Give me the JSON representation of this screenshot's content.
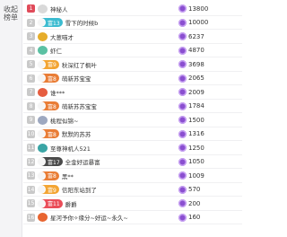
{
  "sidebar": {
    "title_line1": "收起",
    "title_line2": "榜单"
  },
  "colors": {
    "rank_top": "#e04b5a",
    "coin": "#8a4fd0"
  },
  "rows": [
    {
      "rank": "1",
      "level": "",
      "badge_color": "#d9d9d9",
      "name": "神秘人",
      "score": "13800"
    },
    {
      "rank": "2",
      "level": "富13",
      "badge_color": "#3bbbd0",
      "name": "雪下的时候b",
      "score": "10000"
    },
    {
      "rank": "3",
      "level": "",
      "badge_color": "#e6ad2b",
      "name": "大葱喵才",
      "score": "6237"
    },
    {
      "rank": "4",
      "level": "",
      "badge_color": "#5bc1a3",
      "name": "虾仁",
      "score": "4870"
    },
    {
      "rank": "5",
      "level": "富9",
      "badge_color": "#f3a533",
      "name": "秋深红了枫叶",
      "score": "3698"
    },
    {
      "rank": "6",
      "level": "富8",
      "badge_color": "#e97d36",
      "name": "萌新苏宝宝",
      "score": "2065"
    },
    {
      "rank": "7",
      "level": "",
      "badge_color": "#e65d40",
      "name": "谁***",
      "score": "2009"
    },
    {
      "rank": "8",
      "level": "富8",
      "badge_color": "#e97d36",
      "name": "萌新苏苏宝宝",
      "score": "1784"
    },
    {
      "rank": "9",
      "level": "",
      "badge_color": "#9da8c0",
      "name": "桃程似锦~",
      "score": "1500"
    },
    {
      "rank": "10",
      "level": "富8",
      "badge_color": "#e97d36",
      "name": "默默的苏苏",
      "score": "1316"
    },
    {
      "rank": "11",
      "level": "",
      "badge_color": "#3aa5a5",
      "name": "至尊神机人521",
      "score": "1250"
    },
    {
      "rank": "12",
      "level": "富17",
      "badge_color": "#4a4a4a",
      "name": "全金好运暴富",
      "score": "1050"
    },
    {
      "rank": "13",
      "level": "富8",
      "badge_color": "#e97d36",
      "name": "黑**",
      "score": "1009"
    },
    {
      "rank": "14",
      "level": "富9",
      "badge_color": "#f3a533",
      "name": "信阳东站到了",
      "score": "570"
    },
    {
      "rank": "15",
      "level": "富11",
      "badge_color": "#ea4d58",
      "name": "爵爵",
      "score": "200"
    },
    {
      "rank": "16",
      "level": "",
      "badge_color": "#e86531",
      "name": "星河予你✧缘分~好运~永久~",
      "score": "160"
    }
  ]
}
